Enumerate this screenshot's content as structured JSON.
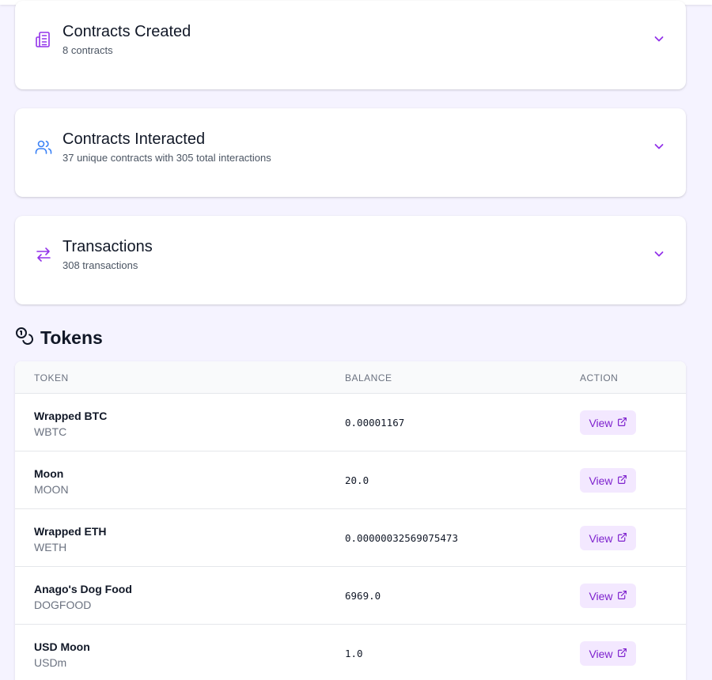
{
  "sections": [
    {
      "title": "Contracts Created",
      "subtitle": "8 contracts",
      "icon": "building-icon",
      "icon_color": "#9333ea"
    },
    {
      "title": "Contracts Interacted",
      "subtitle": "37 unique contracts with 305 total interactions",
      "icon": "users-icon",
      "icon_color": "#3b82f6"
    },
    {
      "title": "Transactions",
      "subtitle": "308 transactions",
      "icon": "arrows-swap-icon",
      "icon_color": "#9333ea"
    }
  ],
  "tokens": {
    "title": "Tokens",
    "icon": "coins-icon",
    "columns": {
      "token": "TOKEN",
      "balance": "BALANCE",
      "action": "ACTION"
    },
    "rows": [
      {
        "name": "Wrapped BTC",
        "symbol": "WBTC",
        "balance": "0.00001167",
        "action": "View"
      },
      {
        "name": "Moon",
        "symbol": "MOON",
        "balance": "20.0",
        "action": "View"
      },
      {
        "name": "Wrapped ETH",
        "symbol": "WETH",
        "balance": "0.00000032569075473",
        "action": "View"
      },
      {
        "name": "Anago's Dog Food",
        "symbol": "DOGFOOD",
        "balance": "6969.0",
        "action": "View"
      },
      {
        "name": "USD Moon",
        "symbol": "USDm",
        "balance": "1.0",
        "action": "View"
      }
    ]
  },
  "colors": {
    "accent": "#9333ea",
    "button_bg": "#f3e8ff",
    "button_text": "#7e22ce",
    "page_bg": "#f5f3ff"
  }
}
